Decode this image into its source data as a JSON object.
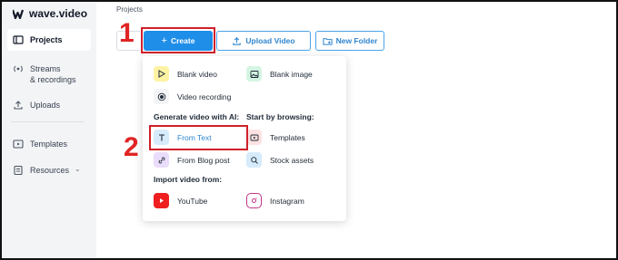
{
  "app": {
    "name": "wave.video"
  },
  "sidebar": {
    "items": [
      {
        "label": "Projects"
      },
      {
        "label_line1": "Streams",
        "label_line2": "& recordings"
      },
      {
        "label": "Uploads"
      },
      {
        "label": "Templates"
      },
      {
        "label": "Resources"
      }
    ]
  },
  "breadcrumb": "Projects",
  "toolbar": {
    "create_label": "Create",
    "upload_label": "Upload Video",
    "new_folder_label": "New Folder"
  },
  "annotations": {
    "step1": "1",
    "step2": "2"
  },
  "menu": {
    "blank_video": "Blank video",
    "blank_image": "Blank image",
    "video_recording": "Video recording",
    "ai_heading": "Generate video with AI:",
    "browse_heading": "Start by browsing:",
    "from_text": "From Text",
    "templates": "Templates",
    "from_blog_post": "From Blog post",
    "stock_assets": "Stock assets",
    "import_heading": "Import video from:",
    "youtube": "YouTube",
    "instagram": "Instagram"
  },
  "colors": {
    "accent": "#1f8ee8",
    "highlight": "#d0202a",
    "yellow_tile": "#fdf3a3",
    "green_tile": "#d5f5e3",
    "purple_tile": "#eadcfb",
    "blue_tile": "#d6ebfb"
  }
}
